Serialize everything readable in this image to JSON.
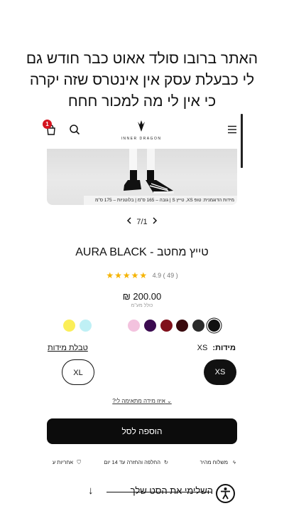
{
  "caption": {
    "line1": "האתר ברובו סולד אאוט כבר חודש גם",
    "line2": "לי כבעלת עסק אין אינטרס שזה יקרה",
    "line3": "כי אין לי מה למכור חחח"
  },
  "header": {
    "cart_count": "1",
    "logo_text": "INNER DRAGON",
    "icons": [
      "cart-icon",
      "search-icon",
      "dragon-logo",
      "menu-icon"
    ]
  },
  "gallery": {
    "model_info": "מידות הדוגמנית: טופ XS, טייץ S | גובה – 165 ס\"מ | בלוטניות – 175 ס\"מ",
    "pager": "7/1"
  },
  "product": {
    "title": "AURA BLACK - טייץ מחטב",
    "rating_stars": 5,
    "rating_text": "4.9 ( 49 )",
    "price": "₪ 200.00",
    "vat_note": "כולל מע\"מ",
    "colors": [
      "#111111",
      "#2b2b2b",
      "#3a0a0e",
      "#80101b",
      "#3b0b50",
      "#f3c2de",
      "#bff0f5",
      "#fbee58"
    ],
    "selected_color_index": 0
  },
  "sizes": {
    "label": "מידות:",
    "selected": "XS",
    "chart_link": "טבלת מידות",
    "options": [
      "XS",
      "XL"
    ],
    "fit_link": "איזו מידה מתאימה לי?"
  },
  "cta": {
    "add_to_cart": "הוספה לסל"
  },
  "benefits": [
    {
      "icon": "lightning-icon",
      "label": "משלוח מהיר"
    },
    {
      "icon": "refresh-icon",
      "label": "החלפה והחזרה עד 14 יום"
    },
    {
      "icon": "shield-icon",
      "label": "אחריות ע"
    }
  ],
  "complete_set": "השלימי את הסט שלך"
}
